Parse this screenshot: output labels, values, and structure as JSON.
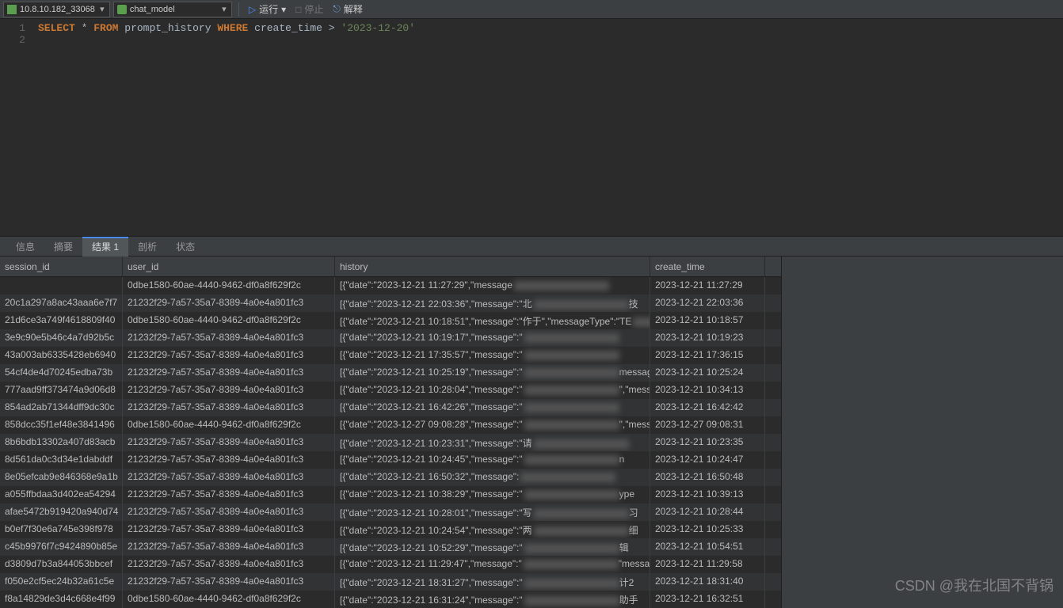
{
  "toolbar": {
    "connection": "10.8.10.182_33068",
    "database": "chat_model",
    "run": "运行",
    "stop": "停止",
    "explain": "解释"
  },
  "editor": {
    "lines": [
      "1",
      "2"
    ],
    "sql": {
      "kw_select": "SELECT",
      "star": "*",
      "kw_from": "FROM",
      "table": "prompt_history",
      "kw_where": "WHERE",
      "col": "create_time",
      "op": ">",
      "val": "'2023-12-20'"
    }
  },
  "tabs": {
    "info": "信息",
    "summary": "摘要",
    "result": "结果 1",
    "profile": "剖析",
    "status": "状态"
  },
  "columns": {
    "session_id": "session_id",
    "user_id": "user_id",
    "history": "history",
    "create_time": "create_time"
  },
  "chart_data": {
    "type": "table",
    "columns": [
      "session_id",
      "user_id",
      "history",
      "create_time"
    ],
    "rows": [
      {
        "session_id": "",
        "user_id": "0dbe1580-60ae-4440-9462-df0a8f629f2c",
        "history": "[{\"date\":\"2023-12-21 11:27:29\",\"message",
        "history_tail": "",
        "create_time": "2023-12-21 11:27:29"
      },
      {
        "session_id": "20c1a297a8ac43aaa6e7f7",
        "user_id": "21232f29-7a57-35a7-8389-4a0e4a801fc3",
        "history": "[{\"date\":\"2023-12-21 22:03:36\",\"message\":\"北",
        "history_tail": "技",
        "create_time": "2023-12-21 22:03:36"
      },
      {
        "session_id": "21d6ce3a749f4618809f40",
        "user_id": "0dbe1580-60ae-4440-9462-df0a8f629f2c",
        "history": "[{\"date\":\"2023-12-21 10:18:51\",\"message\":\"作于\",\"messageType\":\"TE",
        "history_tail": "",
        "create_time": "2023-12-21 10:18:57"
      },
      {
        "session_id": "3e9c90e5b46c4a7d92b5c",
        "user_id": "21232f29-7a57-35a7-8389-4a0e4a801fc3",
        "history": "[{\"date\":\"2023-12-21 10:19:17\",\"message\":\"",
        "history_tail": "",
        "create_time": "2023-12-21 10:19:23"
      },
      {
        "session_id": "43a003ab6335428eb6940",
        "user_id": "21232f29-7a57-35a7-8389-4a0e4a801fc3",
        "history": "[{\"date\":\"2023-12-21 17:35:57\",\"message\":\"",
        "history_tail": "",
        "create_time": "2023-12-21 17:36:15"
      },
      {
        "session_id": "54cf4de4d70245edba73b",
        "user_id": "21232f29-7a57-35a7-8389-4a0e4a801fc3",
        "history": "[{\"date\":\"2023-12-21 10:25:19\",\"message\":\"",
        "history_tail": "messageType",
        "create_time": "2023-12-21 10:25:24"
      },
      {
        "session_id": "777aad9ff373474a9d06d8",
        "user_id": "21232f29-7a57-35a7-8389-4a0e4a801fc3",
        "history": "[{\"date\":\"2023-12-21 10:28:04\",\"message\":\"",
        "history_tail": "\",\"messa",
        "create_time": "2023-12-21 10:34:13"
      },
      {
        "session_id": "854ad2ab71344dff9dc30c",
        "user_id": "21232f29-7a57-35a7-8389-4a0e4a801fc3",
        "history": "[{\"date\":\"2023-12-21 16:42:26\",\"message\":\"",
        "history_tail": "",
        "create_time": "2023-12-21 16:42:42"
      },
      {
        "session_id": "858dcc35f1ef48e3841496",
        "user_id": "0dbe1580-60ae-4440-9462-df0a8f629f2c",
        "history": "[{\"date\":\"2023-12-27 09:08:28\",\"message\":\"",
        "history_tail": "\",\"messageType\":\"TE",
        "create_time": "2023-12-27 09:08:31"
      },
      {
        "session_id": "8b6bdb13302a407d83acb",
        "user_id": "21232f29-7a57-35a7-8389-4a0e4a801fc3",
        "history": "[{\"date\":\"2023-12-21 10:23:31\",\"message\":\"请",
        "history_tail": "",
        "create_time": "2023-12-21 10:23:35"
      },
      {
        "session_id": "8d561da0c3d34e1dabddf",
        "user_id": "21232f29-7a57-35a7-8389-4a0e4a801fc3",
        "history": "[{\"date\":\"2023-12-21 10:24:45\",\"message\":\"",
        "history_tail": "n",
        "create_time": "2023-12-21 10:24:47"
      },
      {
        "session_id": "8e05efcab9e846368e9a1b",
        "user_id": "21232f29-7a57-35a7-8389-4a0e4a801fc3",
        "history": "[{\"date\":\"2023-12-21 16:50:32\",\"message\":",
        "history_tail": "",
        "create_time": "2023-12-21 16:50:48"
      },
      {
        "session_id": "a055ffbdaa3d402ea54294",
        "user_id": "21232f29-7a57-35a7-8389-4a0e4a801fc3",
        "history": "[{\"date\":\"2023-12-21 10:38:29\",\"message\":\"",
        "history_tail": "ype",
        "create_time": "2023-12-21 10:39:13"
      },
      {
        "session_id": "afae5472b919420a940d74",
        "user_id": "21232f29-7a57-35a7-8389-4a0e4a801fc3",
        "history": "[{\"date\":\"2023-12-21 10:28:01\",\"message\":\"写",
        "history_tail": "习",
        "create_time": "2023-12-21 10:28:44"
      },
      {
        "session_id": "b0ef7f30e6a745e398f978",
        "user_id": "21232f29-7a57-35a7-8389-4a0e4a801fc3",
        "history": "[{\"date\":\"2023-12-21 10:24:54\",\"message\":\"两",
        "history_tail": "细",
        "create_time": "2023-12-21 10:25:33"
      },
      {
        "session_id": "c45b9976f7c9424890b85e",
        "user_id": "21232f29-7a57-35a7-8389-4a0e4a801fc3",
        "history": "[{\"date\":\"2023-12-21 10:52:29\",\"message\":\"",
        "history_tail": "辑",
        "create_time": "2023-12-21 10:54:51"
      },
      {
        "session_id": "d3809d7b3a844053bbcef",
        "user_id": "21232f29-7a57-35a7-8389-4a0e4a801fc3",
        "history": "[{\"date\":\"2023-12-21 11:29:47\",\"message\":\"",
        "history_tail": "\"messa",
        "create_time": "2023-12-21 11:29:58"
      },
      {
        "session_id": "f050e2cf5ec24b32a61c5e",
        "user_id": "21232f29-7a57-35a7-8389-4a0e4a801fc3",
        "history": "[{\"date\":\"2023-12-21 18:31:27\",\"message\":\"",
        "history_tail": "计2",
        "create_time": "2023-12-21 18:31:40"
      },
      {
        "session_id": "f8a14829de3d4c668e4f99",
        "user_id": "0dbe1580-60ae-4440-9462-df0a8f629f2c",
        "history": "[{\"date\":\"2023-12-21 16:31:24\",\"message\":\"",
        "history_tail": "助手",
        "create_time": "2023-12-21 16:32:51"
      }
    ]
  },
  "watermark": "CSDN @我在北国不背锅"
}
